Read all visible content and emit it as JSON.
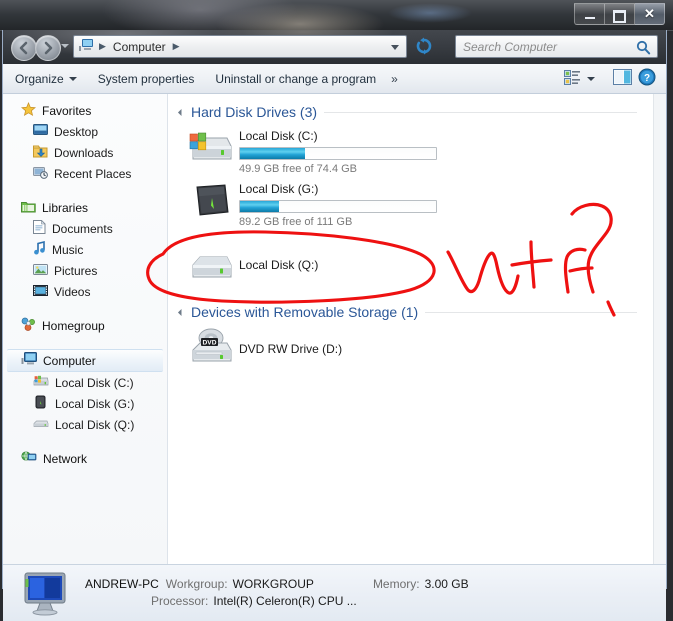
{
  "window": {
    "titlebar_buttons": [
      {
        "name": "minimize",
        "glyph": "—"
      },
      {
        "name": "maximize",
        "glyph": "□"
      },
      {
        "name": "close",
        "glyph": "X"
      }
    ]
  },
  "navigation": {
    "back_tooltip": "Back",
    "forward_tooltip": "Forward",
    "address_crumbs": [
      "Computer"
    ],
    "address_sep": "▸",
    "refresh_tooltip": "Refresh"
  },
  "search": {
    "placeholder": "Search Computer",
    "value": ""
  },
  "toolbar": {
    "organize_label": "Organize",
    "system_properties_label": "System properties",
    "uninstall_label": "Uninstall or change a program",
    "overflow_label": "»",
    "change_view_tooltip": "Change your view",
    "preview_pane_tooltip": "Show the preview pane",
    "help_tooltip": "Get help"
  },
  "sidebar": {
    "groups": [
      {
        "header": "Favorites",
        "icon": "star-icon",
        "items": [
          {
            "label": "Desktop",
            "icon": "desktop-icon"
          },
          {
            "label": "Downloads",
            "icon": "downloads-icon"
          },
          {
            "label": "Recent Places",
            "icon": "recent-places-icon"
          }
        ]
      },
      {
        "header": "Libraries",
        "icon": "libraries-icon",
        "items": [
          {
            "label": "Documents",
            "icon": "documents-icon"
          },
          {
            "label": "Music",
            "icon": "music-icon"
          },
          {
            "label": "Pictures",
            "icon": "pictures-icon"
          },
          {
            "label": "Videos",
            "icon": "videos-icon"
          }
        ]
      },
      {
        "header": "Homegroup",
        "icon": "homegroup-icon",
        "items": []
      },
      {
        "header": "Computer",
        "icon": "computer-icon",
        "selected": true,
        "items": [
          {
            "label": "Local Disk (C:)",
            "icon": "drive-c-icon"
          },
          {
            "label": "Local Disk (G:)",
            "icon": "drive-g-icon"
          },
          {
            "label": "Local Disk (Q:)",
            "icon": "drive-q-icon"
          }
        ]
      },
      {
        "header": "Network",
        "icon": "network-icon",
        "items": []
      }
    ]
  },
  "content": {
    "groups": [
      {
        "title": "Hard Disk Drives (3)",
        "drives": [
          {
            "name": "Local Disk (C:)",
            "icon": "windows-drive-icon",
            "has_bar": true,
            "used_percent": 33,
            "free_text": "49.9 GB free of 74.4 GB"
          },
          {
            "name": "Local Disk (G:)",
            "icon": "external-drive-icon",
            "has_bar": true,
            "used_percent": 20,
            "free_text": "89.2 GB free of 111 GB"
          },
          {
            "name": "Local Disk (Q:)",
            "icon": "plain-drive-icon",
            "has_bar": false,
            "used_percent": 0,
            "free_text": ""
          }
        ]
      },
      {
        "title": "Devices with Removable Storage (1)",
        "drives": [
          {
            "name": "DVD RW Drive (D:)",
            "icon": "dvd-drive-icon",
            "has_bar": false,
            "used_percent": 0,
            "free_text": ""
          }
        ]
      }
    ]
  },
  "status": {
    "computer_name": "ANDREW-PC",
    "workgroup_label": "Workgroup:",
    "workgroup_value": "WORKGROUP",
    "memory_label": "Memory:",
    "memory_value": "3.00 GB",
    "processor_label": "Processor:",
    "processor_value": "Intel(R) Celeron(R) CPU ..."
  },
  "annotation": {
    "color": "#ee1111",
    "text": "WTF?",
    "shape": "ellipse-circling-local-disk-q"
  }
}
